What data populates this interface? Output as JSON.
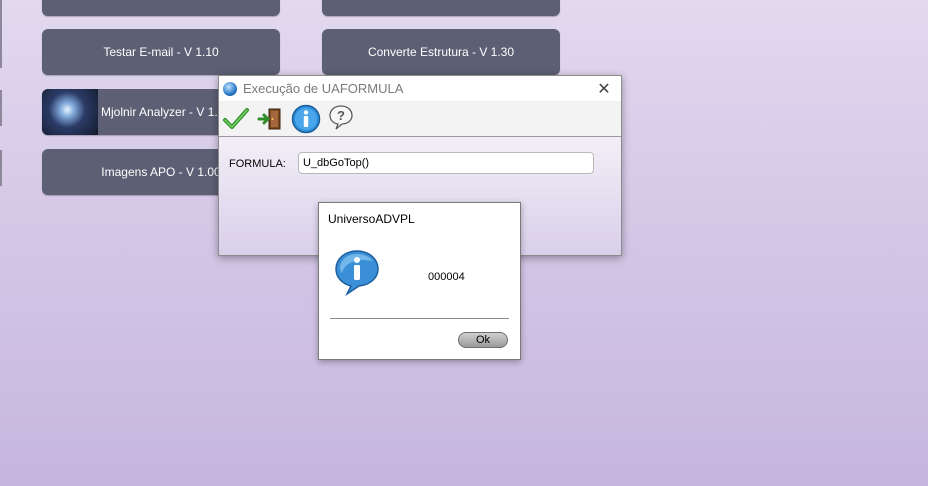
{
  "desktop": {
    "buttons": [
      {
        "label": ""
      },
      {
        "label": ""
      },
      {
        "label": "Testar E-mail - V 1.10"
      },
      {
        "label": "Converte Estrutura - V 1.30"
      },
      {
        "label": "Mjolnir Analyzer - V 1.00"
      },
      {
        "label": "Imagens APO - V 1.00"
      }
    ]
  },
  "dialog": {
    "title": "Execução de UAFORMULA",
    "close_glyph": "✕",
    "toolbar": {
      "icons": [
        "check-icon",
        "exit-door-icon",
        "info-icon",
        "help-icon"
      ]
    },
    "formula_label": "FORMULA:",
    "formula_value": "U_dbGoTop()"
  },
  "message_box": {
    "title": "UniversoADVPL",
    "icon": "info-bubble-icon",
    "message": "000004",
    "ok_label": "Ok"
  },
  "colors": {
    "button_bg": "#5d6075",
    "background_top": "#e2d9ef",
    "background_bottom": "#c6b6de"
  }
}
